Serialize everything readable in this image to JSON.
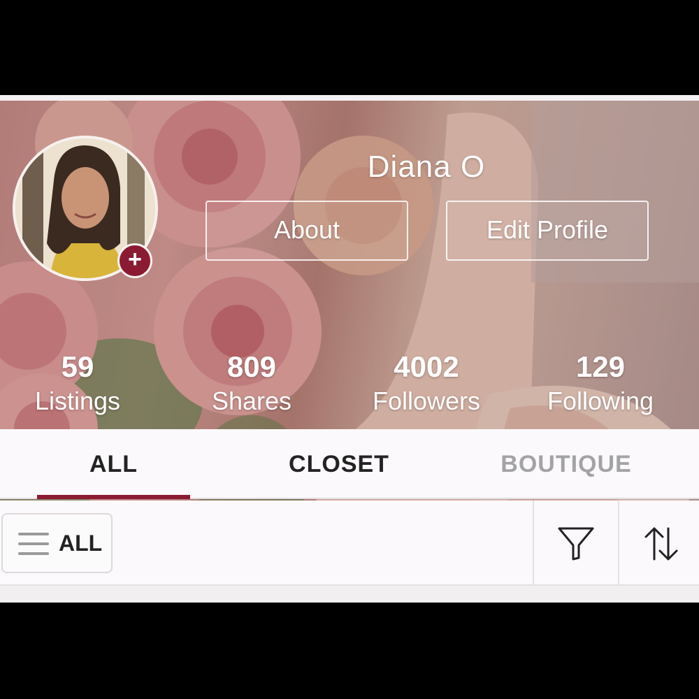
{
  "profile": {
    "name": "Diana O",
    "about_label": "About",
    "edit_label": "Edit Profile",
    "avatar_badge": "+"
  },
  "stats": [
    {
      "value": "59",
      "label": "Listings"
    },
    {
      "value": "809",
      "label": "Shares"
    },
    {
      "value": "4002",
      "label": "Followers"
    },
    {
      "value": "129",
      "label": "Following"
    }
  ],
  "tabs": [
    {
      "label": "ALL",
      "active": true
    },
    {
      "label": "CLOSET",
      "active": false
    },
    {
      "label": "BOUTIQUE",
      "active": false
    }
  ],
  "filters": {
    "category_label": "ALL",
    "filter_icon": "funnel-icon",
    "sort_icon": "sort-arrows-icon"
  },
  "colors": {
    "accent": "#8a1b33",
    "inactive_tab": "#a3a3a5"
  }
}
